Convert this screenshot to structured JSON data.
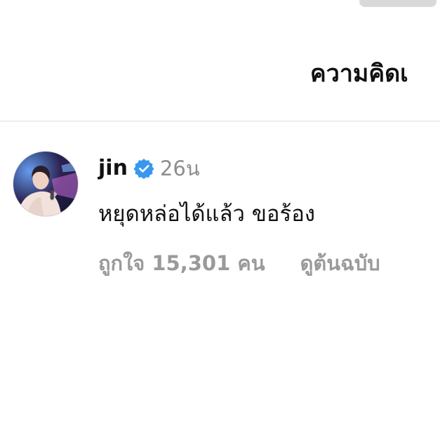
{
  "sheet": {
    "title": "ความคิดเ"
  },
  "comment": {
    "username": "jin",
    "verified": true,
    "timestamp": "26น",
    "text": "หยุดหล่อได้แล้ว ขอร้อง",
    "likes_text": "ถูกใจ 15,301 คน",
    "see_original_label": "ดูต้นฉบับ"
  },
  "icons": {
    "verified": "verified-badge-icon",
    "avatar": "profile-photo"
  },
  "colors": {
    "verified_badge": "#3897f0",
    "secondary_text": "#8e8e8e",
    "divider": "#dedede"
  }
}
